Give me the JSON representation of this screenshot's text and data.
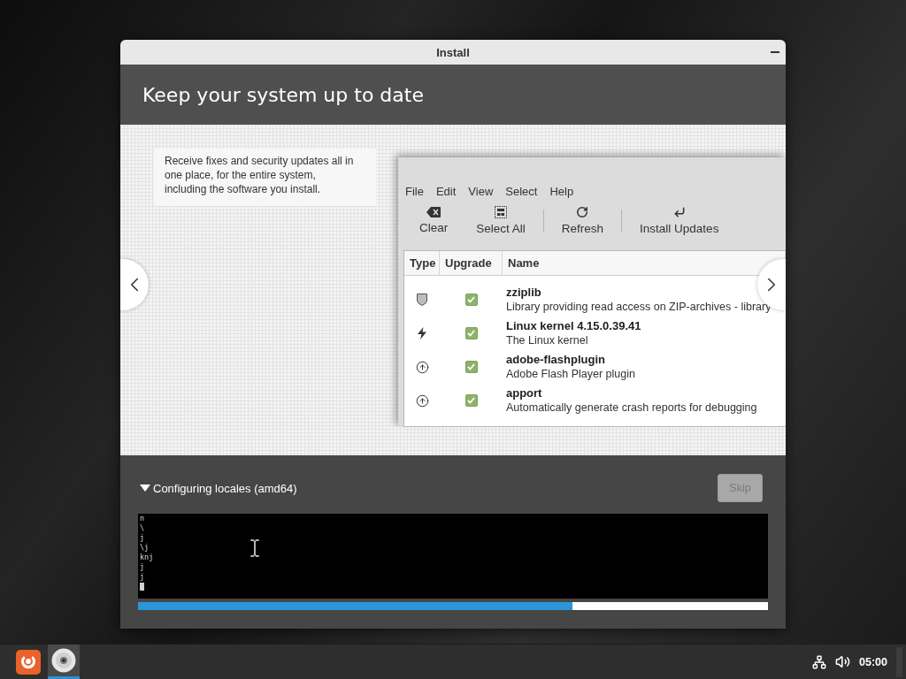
{
  "window": {
    "title": "Install"
  },
  "header": {
    "title": "Keep your system up to date"
  },
  "slide": {
    "description": "Receive fixes and security updates all in one place, for the entire system, including the software you install.",
    "screenshot": {
      "menu": [
        "File",
        "Edit",
        "View",
        "Select",
        "Help"
      ],
      "toolbar": [
        [
          {
            "kind": "clear",
            "label": "Clear"
          },
          {
            "kind": "select-all",
            "label": "Select All"
          }
        ],
        [
          {
            "kind": "refresh",
            "label": "Refresh"
          }
        ],
        [
          {
            "kind": "install",
            "label": "Install Updates"
          }
        ]
      ],
      "table": {
        "columns": [
          "Type",
          "Upgrade",
          "Name"
        ],
        "rows": [
          {
            "kind": "security",
            "checked": true,
            "name": "zziplib",
            "description": "Library providing read access on ZIP-archives - library"
          },
          {
            "kind": "kernel",
            "checked": true,
            "name": "Linux kernel 4.15.0.39.41",
            "description": "The Linux kernel"
          },
          {
            "kind": "package",
            "checked": true,
            "name": "adobe-flashplugin",
            "description": "Adobe Flash Player plugin"
          },
          {
            "kind": "package",
            "checked": true,
            "name": "apport",
            "description": "Automatically generate crash reports for debugging"
          }
        ]
      }
    }
  },
  "progress": {
    "expanded": true,
    "label": "Configuring locales (amd64)",
    "skip": {
      "label": "Skip",
      "disabled": true
    },
    "terminal_lines": [
      "n",
      "\\",
      "j",
      "\\j",
      "knj",
      "j",
      "j"
    ],
    "level": 0.69
  },
  "taskbar": {
    "tasks": [
      {
        "kind": "disc",
        "selected": true
      }
    ],
    "clock": "05:00"
  }
}
